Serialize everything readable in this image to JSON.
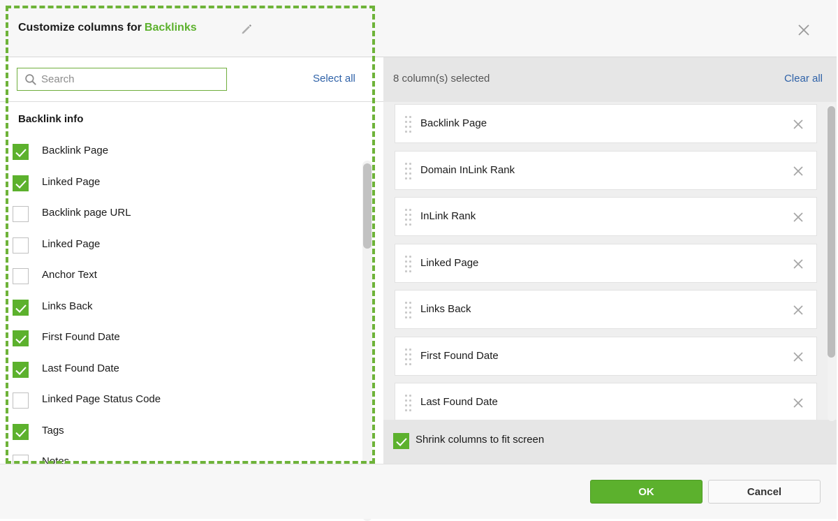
{
  "header": {
    "title_prefix": "Customize columns for",
    "entity": "Backlinks",
    "edit_icon": "pencil-icon",
    "close_icon": "close-icon",
    "accent_green": "#5cb12d",
    "link_blue": "#2f62a8"
  },
  "left": {
    "search": {
      "icon": "search-icon",
      "placeholder": "Search",
      "value": ""
    },
    "select_all_label": "Select all",
    "group_title": "Backlink info",
    "columns": [
      {
        "label": "Backlink Page",
        "checked": true
      },
      {
        "label": "Linked Page",
        "checked": true
      },
      {
        "label": "Backlink page URL",
        "checked": false
      },
      {
        "label": "Linked Page",
        "checked": false
      },
      {
        "label": "Anchor Text",
        "checked": false
      },
      {
        "label": "Links Back",
        "checked": true
      },
      {
        "label": "First Found Date",
        "checked": true
      },
      {
        "label": "Last Found Date",
        "checked": true
      },
      {
        "label": "Linked Page Status Code",
        "checked": false
      },
      {
        "label": "Tags",
        "checked": true
      },
      {
        "label": "Notes",
        "checked": false
      }
    ]
  },
  "right": {
    "count_label": "8 column(s) selected",
    "clear_all_label": "Clear all",
    "selected": [
      {
        "label": "Backlink Page"
      },
      {
        "label": "Domain InLink Rank"
      },
      {
        "label": "InLink Rank"
      },
      {
        "label": "Linked Page"
      },
      {
        "label": "Links Back"
      },
      {
        "label": "First Found Date"
      },
      {
        "label": "Last Found Date"
      }
    ],
    "shrink": {
      "label": "Shrink columns to fit screen",
      "checked": true
    }
  },
  "footer": {
    "ok_label": "OK",
    "cancel_label": "Cancel"
  }
}
